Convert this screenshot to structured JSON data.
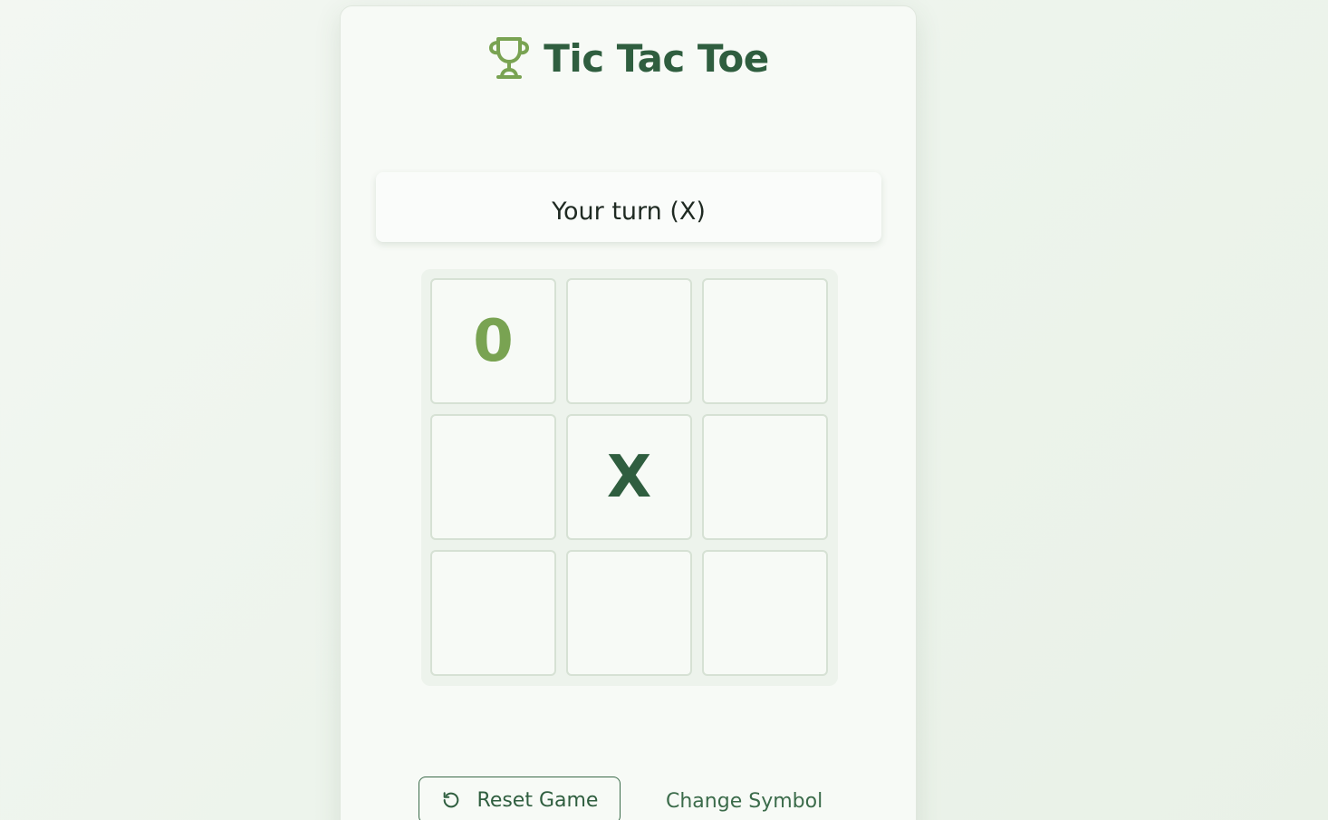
{
  "header": {
    "title": "Tic Tac Toe",
    "icon": "trophy-icon"
  },
  "status": {
    "text": "Your turn (X)"
  },
  "board": {
    "cells": [
      "0",
      "",
      "",
      "",
      "X",
      "",
      "",
      "",
      ""
    ]
  },
  "controls": {
    "reset_label": "Reset Game",
    "reset_icon": "rotate-ccw-icon",
    "change_label": "Change Symbol"
  },
  "colors": {
    "primary": "#2f5e3f",
    "accent": "#79a352",
    "background": "#f7faf6"
  }
}
